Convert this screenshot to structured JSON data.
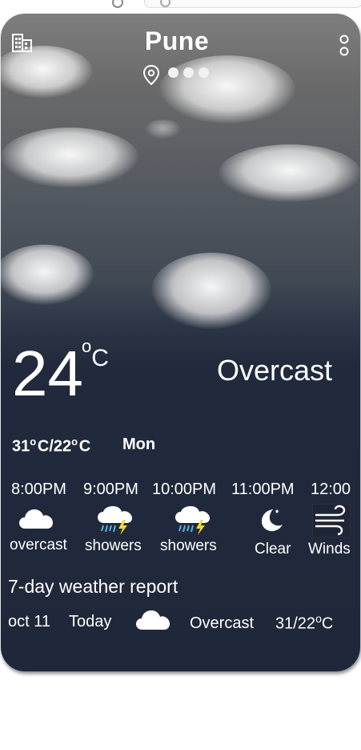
{
  "current": {
    "city": "Pune",
    "temperature": "24",
    "unit": "C",
    "degree_symbol": "o",
    "condition": "Overcast",
    "high": "31",
    "low": "22",
    "day": "Mon"
  },
  "pager": {
    "count": 3,
    "active": 0
  },
  "icons": {
    "building": "building-icon",
    "location": "location-pin-icon",
    "menu": "more-vertical-icon"
  },
  "hourly": [
    {
      "time": "8:00PM",
      "desc": "overcast",
      "icon": "cloud-icon"
    },
    {
      "time": "9:00PM",
      "desc": "showers",
      "icon": "rain-thunder-icon"
    },
    {
      "time": "10:00PM",
      "desc": "showers",
      "icon": "rain-thunder-icon"
    },
    {
      "time": "11:00PM",
      "desc": "Clear",
      "icon": "moon-star-icon"
    },
    {
      "time": "12:00",
      "desc": "Winds",
      "icon": "wind-icon"
    }
  ],
  "report": {
    "title": "7-day weather report",
    "rows": [
      {
        "date": "oct 11",
        "day": "Today",
        "icon": "cloud-icon",
        "condition": "Overcast",
        "temp": "31/22",
        "unit": "C",
        "degree_symbol": "o"
      }
    ]
  },
  "colors": {
    "background_top": "#7e7e7e",
    "background_bottom": "#1f283a",
    "text": "#ffffff",
    "lightning": "#f2d63a",
    "rain": "#5ab4e6"
  }
}
